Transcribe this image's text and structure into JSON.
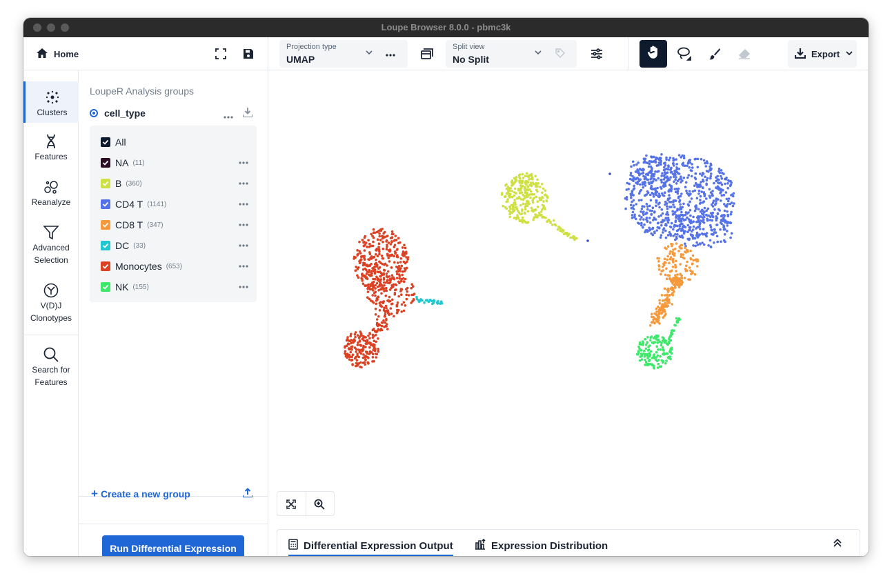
{
  "window": {
    "title": "Loupe Browser 8.0.0 - pbmc3k"
  },
  "topbar": {
    "home_label": "Home",
    "projection": {
      "label": "Projection type",
      "value": "UMAP"
    },
    "split": {
      "label": "Split view",
      "value": "No Split"
    },
    "export_label": "Export"
  },
  "nav": {
    "items": [
      {
        "label": "Clusters",
        "icon": "clusters-icon",
        "active": true
      },
      {
        "label": "Features",
        "icon": "features-icon"
      },
      {
        "label": "Reanalyze",
        "icon": "reanalyze-icon"
      },
      {
        "label": "Advanced Selection",
        "icon": "filter-icon"
      },
      {
        "label": "V(D)J Clonotypes",
        "icon": "vdj-icon"
      },
      {
        "label": "Search for Features",
        "icon": "search-icon"
      }
    ]
  },
  "panel": {
    "heading": "LoupeR Analysis groups",
    "group_name": "cell_type",
    "all_label": "All",
    "categories": [
      {
        "label": "NA",
        "count": "(11)",
        "color": "#2a0f24"
      },
      {
        "label": "B",
        "count": "(360)",
        "color": "#cfe044"
      },
      {
        "label": "CD4 T",
        "count": "(1141)",
        "color": "#5572e6"
      },
      {
        "label": "CD8 T",
        "count": "(347)",
        "color": "#f5993d"
      },
      {
        "label": "DC",
        "count": "(33)",
        "color": "#21c6cf"
      },
      {
        "label": "Monocytes",
        "count": "(653)",
        "color": "#db4224"
      },
      {
        "label": "NK",
        "count": "(155)",
        "color": "#3ee86b"
      }
    ],
    "create_group_label": "Create a new group",
    "run_button_label": "Run Differential Expression"
  },
  "bottom_tabs": [
    {
      "label": "Differential Expression Output",
      "active": true
    },
    {
      "label": "Expression Distribution"
    }
  ],
  "colors": {
    "accent": "#1f66d6",
    "dark": "#0e1b2e"
  }
}
